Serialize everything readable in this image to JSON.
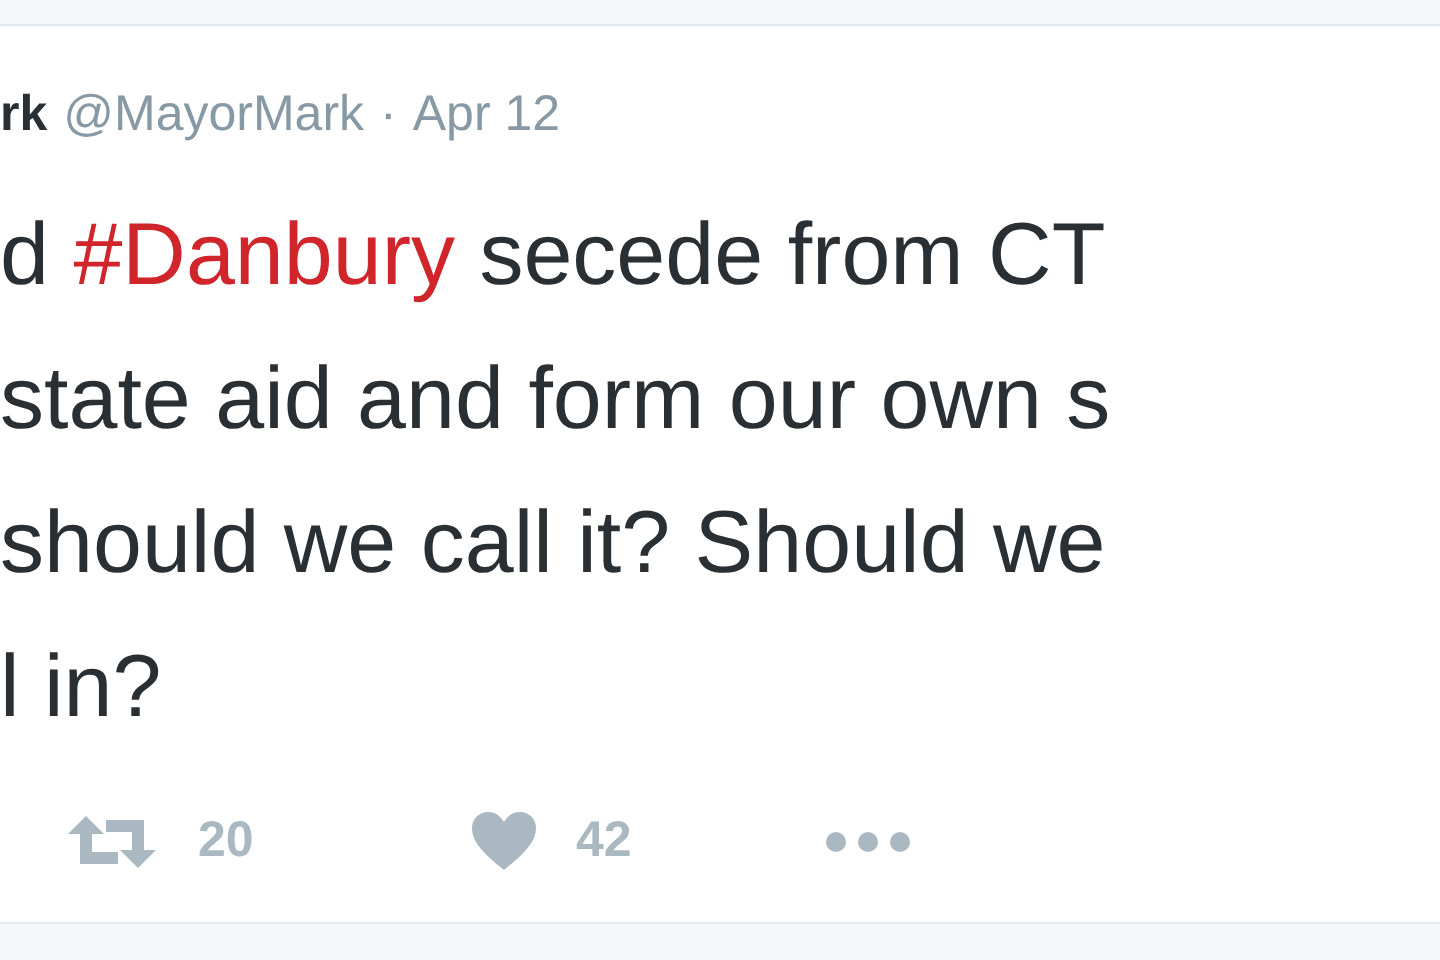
{
  "tweet": {
    "name": "rk",
    "handle": "@MayorMark",
    "separator": "·",
    "date": "Apr 12",
    "lines": [
      [
        {
          "kind": "text",
          "text": "d "
        },
        {
          "kind": "hashtag",
          "text": "#Danbury"
        },
        {
          "kind": "text",
          "text": " secede from CT"
        }
      ],
      [
        {
          "kind": "text",
          "text": "state aid and form our own s"
        }
      ],
      [
        {
          "kind": "text",
          "text": "should we call it? Should we"
        }
      ],
      [
        {
          "kind": "text",
          "text": "l in?"
        }
      ]
    ],
    "actions": [
      {
        "kind": "retweet",
        "count": "20"
      },
      {
        "kind": "like",
        "count": "42"
      },
      {
        "kind": "more"
      }
    ]
  }
}
